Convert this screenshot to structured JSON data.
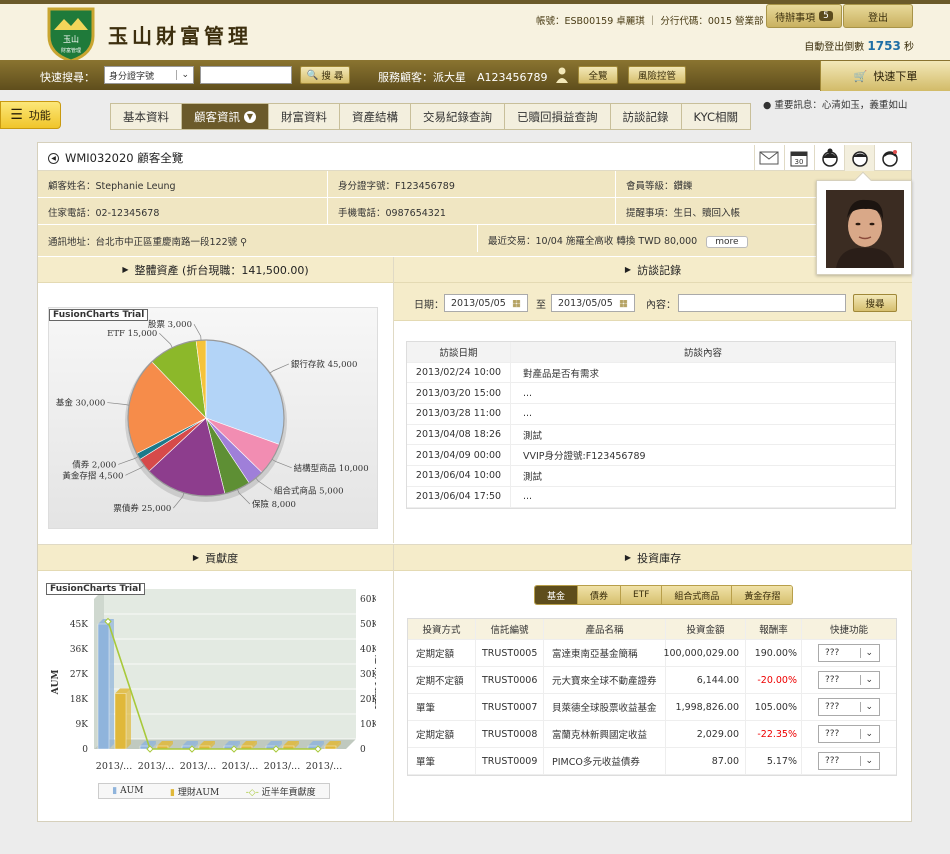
{
  "header": {
    "brand": "玉山財富管理",
    "logo_text": "玉山 財富管理",
    "account_line": "帳號：ESB00159 卓麗琪 ｜ 分行代碼：0015 營業部",
    "pending_label": "待辦事項",
    "pending_count": "5",
    "logout_label": "登出",
    "countdown_prefix": "自動登出倒數",
    "countdown_value": "1753",
    "countdown_suffix": "秒"
  },
  "searchbar": {
    "quick_label": "快速搜尋：",
    "select_value": "身分證字號",
    "search_btn": "搜 尋",
    "client_label": "服務顧客：派大星　A123456789",
    "overview_btn": "全覽",
    "risk_btn": "風險控管",
    "buy_btn": "快速下單"
  },
  "nav": {
    "func_label": "功能",
    "tabs": [
      "基本資料",
      "顧客資訊",
      "財富資料",
      "資產結構",
      "交易紀錄查詢",
      "已贖回損益查詢",
      "訪談記錄",
      "KYC相關"
    ],
    "notice": "重要訊息：心清如玉，義重如山"
  },
  "card": {
    "title": "WMI032020 顧客全覽"
  },
  "info": {
    "name": "顧客姓名：Stephanie Leung",
    "id": "身分證字號：F123456789",
    "level": "會員等級：鑽鑠",
    "home_phone": "住家電話：02-12345678",
    "mobile": "手機電話：0987654321",
    "reminder": "提醒事項：生日、贖回入帳",
    "address": "通訊地址：台北市中正區重慶南路一段122號",
    "recent_prefix": "最近交易：10/04 施羅全高收 轉換 TWD 80,000",
    "more_btn": "more"
  },
  "assets": {
    "title": "整體資產 (折台現職：141,500.00)",
    "trial": "FusionCharts Trial"
  },
  "chart_data": [
    {
      "type": "pie",
      "title": "",
      "slices": [
        {
          "label": "銀行存款",
          "value": 45000,
          "color": "#b3d4f7",
          "text": "銀行存款 45,000"
        },
        {
          "label": "結構型商品",
          "value": 10000,
          "color": "#f28db2",
          "text": "結構型商品 10,000"
        },
        {
          "label": "組合式商品",
          "value": 5000,
          "color": "#9f7fd9",
          "text": "組合式商品 5,000"
        },
        {
          "label": "保險",
          "value": 8000,
          "color": "#5e8f34",
          "text": "保險 8,000"
        },
        {
          "label": "票債券",
          "value": 25000,
          "color": "#8d3d8d",
          "text": "票債券 25,000"
        },
        {
          "label": "黃金存摺",
          "value": 4500,
          "color": "#d64a4a",
          "text": "黃金存摺 4,500"
        },
        {
          "label": "債券",
          "value": 2000,
          "color": "#1c7a8a",
          "text": "債券 2,000"
        },
        {
          "label": "基金",
          "value": 30000,
          "color": "#f68c4a",
          "text": "基金 30,000"
        },
        {
          "label": "ETF",
          "value": 15000,
          "color": "#8cb82a",
          "text": "ETF 15,000"
        },
        {
          "label": "股票",
          "value": 3000,
          "color": "#f5c33b",
          "text": "股票 3,000"
        }
      ]
    },
    {
      "type": "bar",
      "title": "",
      "xlabel": "",
      "ylabel": "AUM",
      "y2label": "近半年貢獻度",
      "categories": [
        "2013/...",
        "2013/...",
        "2013/...",
        "2013/...",
        "2013/...",
        "2013/..."
      ],
      "y_ticks": [
        "0",
        "9K",
        "18K",
        "27K",
        "36K",
        "45K"
      ],
      "y2_ticks": [
        "0",
        "10K",
        "20K",
        "30K",
        "40K",
        "50K",
        "60K"
      ],
      "ylim": [
        0,
        54000
      ],
      "y2lim": [
        0,
        60000
      ],
      "series": [
        {
          "name": "AUM",
          "values": [
            45000,
            0,
            0,
            0,
            0,
            0
          ],
          "color": "#8fb4dc"
        },
        {
          "name": "理財AUM",
          "values": [
            20000,
            0,
            0,
            0,
            0,
            0
          ],
          "color": "#e0b83a"
        },
        {
          "name": "近半年貢獻度",
          "values": [
            51000,
            0,
            0,
            0,
            0,
            0
          ],
          "color": "#a8c93a",
          "axis": "right"
        }
      ]
    }
  ],
  "visits": {
    "title": "訪談記錄",
    "date_label": "日期：",
    "date_from": "2013/05/05",
    "to_label": "至",
    "date_to": "2013/05/05",
    "content_label": "內容：",
    "search_btn": "搜尋",
    "col_date": "訪談日期",
    "col_content": "訪談內容",
    "rows": [
      [
        "2013/02/24  10:00",
        "對產品是否有需求"
      ],
      [
        "2013/03/20  15:00",
        "..."
      ],
      [
        "2013/03/28  11:00",
        "..."
      ],
      [
        "2013/04/08  18:26",
        "測試"
      ],
      [
        "2013/04/09  00:00",
        "VVIP身分證號:F123456789"
      ],
      [
        "2013/06/04  10:00",
        "測試"
      ],
      [
        "2013/06/04  17:50",
        "..."
      ]
    ]
  },
  "contribution": {
    "title": "貢獻度",
    "trial": "FusionCharts Trial",
    "legend": [
      "AUM",
      "理財AUM",
      "近半年貢獻度"
    ]
  },
  "holdings": {
    "title": "投資庫存",
    "tabs": [
      "基金",
      "債券",
      "ETF",
      "組合式商品",
      "黃金存摺"
    ],
    "headers": [
      "投資方式",
      "信託編號",
      "產品名稱",
      "投資金額",
      "報酬率",
      "快捷功能"
    ],
    "rows": [
      [
        "定期定額",
        "TRUST0005",
        "富達東南亞基金簡稱",
        "100,000,029.00",
        "190.00%",
        "???"
      ],
      [
        "定期不定額",
        "TRUST0006",
        "元大寶來全球不動產證券",
        "6,144.00",
        "-20.00%",
        "???"
      ],
      [
        "單筆",
        "TRUST0007",
        "貝萊德全球股票收益基金",
        "1,998,826.00",
        "105.00%",
        "???"
      ],
      [
        "定期定額",
        "TRUST0008",
        "富蘭克林新興國定收益",
        "2,029.00",
        "-22.35%",
        "???"
      ],
      [
        "單筆",
        "TRUST0009",
        "PIMCO多元收益債券",
        "87.00",
        "5.17%",
        "???"
      ]
    ]
  }
}
